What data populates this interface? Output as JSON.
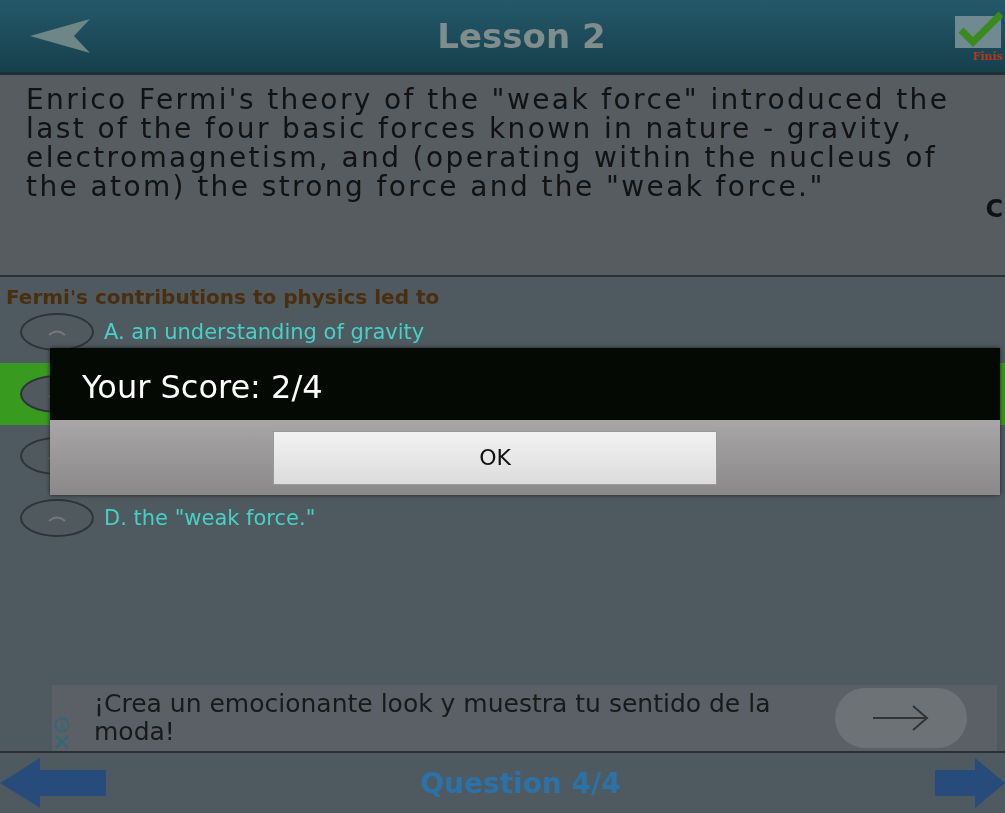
{
  "header": {
    "title": "Lesson 2",
    "finish_label": "Finis"
  },
  "passage": {
    "text": "Enrico Fermi's theory of the \"weak force\" introduced the last of the four basic forces known in nature - gravity, electromagnetism, and (operating within the nucleus of the atom) the strong force and the \"weak force.\"",
    "corner_text": "C"
  },
  "question": "Fermi's contributions to physics led to",
  "options": [
    {
      "label": "A. an understanding of gravity",
      "highlighted": false
    },
    {
      "highlighted": true
    },
    {
      "highlighted": false
    },
    {
      "label": "D. the \"weak force.\"",
      "highlighted": false
    }
  ],
  "dialog": {
    "title": "Your Score: 2/4",
    "button": "OK"
  },
  "ad": {
    "text": "¡Crea un emocionante look y muestra tu sentido de la moda!"
  },
  "footer": {
    "label": "Question 4/4"
  }
}
